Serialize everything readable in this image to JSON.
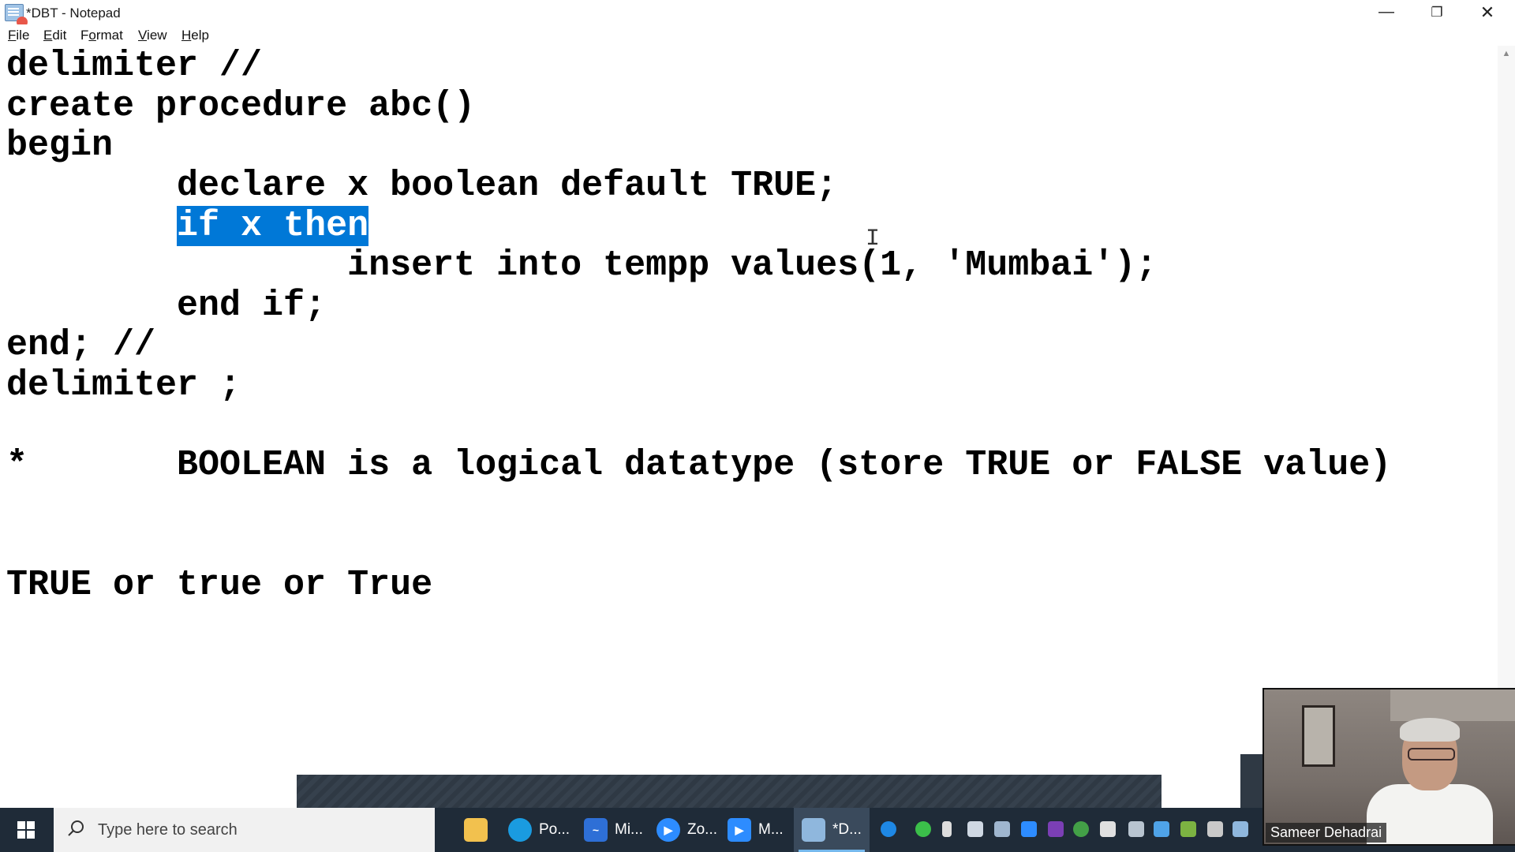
{
  "window": {
    "title": "*DBT - Notepad",
    "controls": {
      "minimize": "—",
      "maximize": "❐",
      "close": "✕"
    }
  },
  "menu": [
    {
      "key": "F",
      "rest": "ile"
    },
    {
      "key": "E",
      "rest": "dit"
    },
    {
      "key": "",
      "rest": "Format",
      "underline_index": 1
    },
    {
      "key": "V",
      "rest": "iew"
    },
    {
      "key": "H",
      "rest": "elp"
    }
  ],
  "editor": {
    "lines": {
      "l1": "delimiter //",
      "l2": "create procedure abc()",
      "l3": "begin",
      "l4": "        declare x boolean default TRUE;",
      "l5_indent": "        ",
      "l5_selected": "if x then",
      "l6": "                insert into tempp values(1, 'Mumbai');",
      "l7": "        end if;",
      "l8": "end; //",
      "l9": "delimiter ;",
      "l10": "*       BOOLEAN is a logical datatype (store TRUE or FALSE value)",
      "l11": "TRUE or true or True"
    }
  },
  "taskbar": {
    "search_placeholder": "Type here to search",
    "apps": [
      {
        "label": "",
        "icon": "file-explorer-icon",
        "color": "#f2c14e"
      },
      {
        "label": "Po...",
        "icon": "edge-icon",
        "color": "#1a9be0"
      },
      {
        "label": "Mi...",
        "icon": "whiteboard-icon",
        "color": "#2e6fd6"
      },
      {
        "label": "Zo...",
        "icon": "zoom-icon",
        "color": "#2d8cff"
      },
      {
        "label": "M...",
        "icon": "zoom-meeting-icon",
        "color": "#2d8cff"
      },
      {
        "label": "*D...",
        "icon": "notepad-icon",
        "color": "#8fb7dd"
      }
    ]
  },
  "webcam": {
    "name": "Sameer Dehadrai"
  }
}
